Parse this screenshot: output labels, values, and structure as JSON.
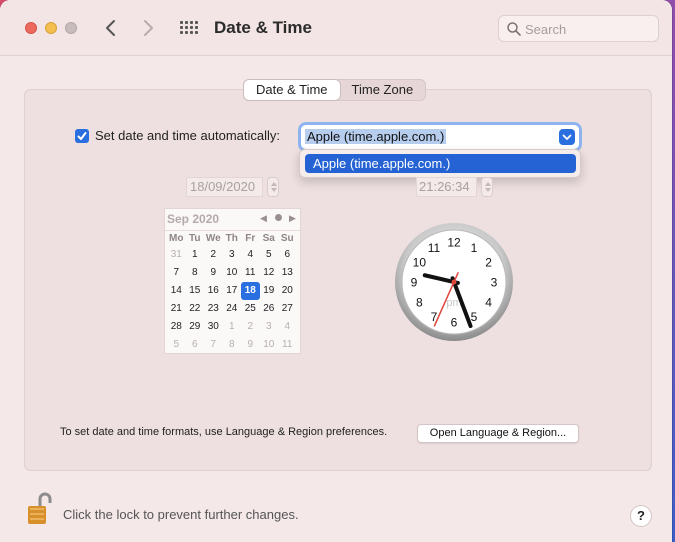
{
  "window": {
    "title": "Date & Time",
    "search_placeholder": "Search"
  },
  "tabs": [
    {
      "label": "Date & Time",
      "active": true
    },
    {
      "label": "Time Zone",
      "active": false
    }
  ],
  "auto": {
    "label": "Set date and time automatically:",
    "checked": true,
    "server_value": "Apple (time.apple.com.)",
    "dropdown_options": [
      "Apple (time.apple.com.)"
    ]
  },
  "date_value": "18/09/2020",
  "time_value": "21:26:34",
  "calendar": {
    "month": "Sep 2020",
    "weekdays": [
      "Mo",
      "Tu",
      "We",
      "Th",
      "Fr",
      "Sa",
      "Su"
    ],
    "selected_day": "18",
    "weeks": [
      [
        "31",
        "1",
        "2",
        "3",
        "4",
        "5",
        "6"
      ],
      [
        "7",
        "8",
        "9",
        "10",
        "11",
        "12",
        "13"
      ],
      [
        "14",
        "15",
        "16",
        "17",
        "18",
        "19",
        "20"
      ],
      [
        "21",
        "22",
        "23",
        "24",
        "25",
        "26",
        "27"
      ],
      [
        "28",
        "29",
        "30",
        "1",
        "2",
        "3",
        "4"
      ],
      [
        "5",
        "6",
        "7",
        "8",
        "9",
        "10",
        "11"
      ]
    ],
    "other_month_cells": [
      [
        0,
        0
      ],
      [
        4,
        3
      ],
      [
        4,
        4
      ],
      [
        4,
        5
      ],
      [
        4,
        6
      ],
      [
        5,
        0
      ],
      [
        5,
        1
      ],
      [
        5,
        2
      ],
      [
        5,
        3
      ],
      [
        5,
        4
      ],
      [
        5,
        5
      ],
      [
        5,
        6
      ]
    ]
  },
  "clock": {
    "numerals": [
      "12",
      "1",
      "2",
      "3",
      "4",
      "5",
      "6",
      "7",
      "8",
      "9",
      "10",
      "11"
    ],
    "ampm": "pm",
    "time": {
      "hours": 21,
      "minutes": 26,
      "seconds": 34
    }
  },
  "formats_text": "To set date and time formats, use Language & Region preferences.",
  "region_button": "Open Language & Region...",
  "lock_text": "Click the lock to prevent further changes.",
  "help_label": "?",
  "colors": {
    "accent": "#2a6fe0",
    "second_hand": "#e0453a"
  }
}
